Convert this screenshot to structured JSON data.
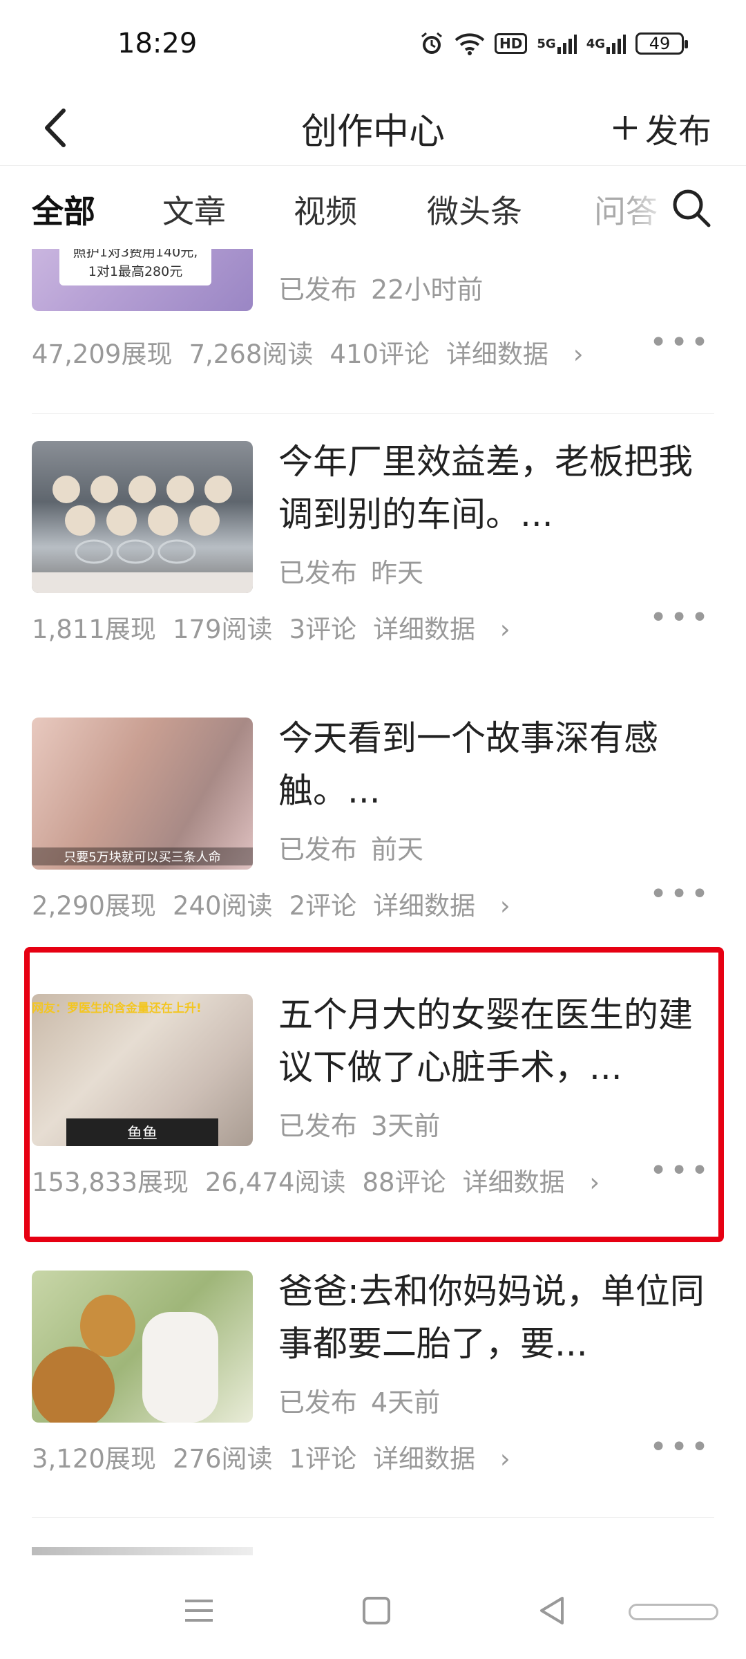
{
  "status": {
    "time": "18:29",
    "battery": "49",
    "net1": "5G",
    "net2": "4G",
    "hd": "HD"
  },
  "header": {
    "title": "创作中心",
    "publish_label": "发布"
  },
  "tabs": [
    {
      "label": "全部",
      "active": true
    },
    {
      "label": "文章"
    },
    {
      "label": "视频"
    },
    {
      "label": "微头条"
    },
    {
      "label": "问答"
    }
  ],
  "items": [
    {
      "headline": "",
      "thumb_caption": "照护1对3费用140元,\n1对1最高280元",
      "status": "已发布",
      "time": "22小时前",
      "views": "47,209展现",
      "reads": "7,268阅读",
      "comments": "410评论",
      "detail": "详细数据"
    },
    {
      "headline": "今年厂里效益差，老板把我调到别的车间。...",
      "thumb_caption": "",
      "status": "已发布",
      "time": "昨天",
      "views": "1,811展现",
      "reads": "179阅读",
      "comments": "3评论",
      "detail": "详细数据"
    },
    {
      "headline": "今天看到一个故事深有感触。...",
      "thumb_caption": "只要5万块就可以买三条人命",
      "status": "已发布",
      "time": "前天",
      "views": "2,290展现",
      "reads": "240阅读",
      "comments": "2评论",
      "detail": "详细数据"
    },
    {
      "headline": "五个月大的女婴在医生的建议下做了心脏手术，...",
      "thumb_caption": "鱼鱼",
      "thumb_top": "网友：罗医生的含金量还在上升!",
      "status": "已发布",
      "time": "3天前",
      "views": "153,833展现",
      "reads": "26,474阅读",
      "comments": "88评论",
      "detail": "详细数据"
    },
    {
      "headline": "爸爸:去和你妈妈说，单位同事都要二胎了，要...",
      "thumb_caption": "",
      "status": "已发布",
      "time": "4天前",
      "views": "3,120展现",
      "reads": "276阅读",
      "comments": "1评论",
      "detail": "详细数据"
    }
  ]
}
